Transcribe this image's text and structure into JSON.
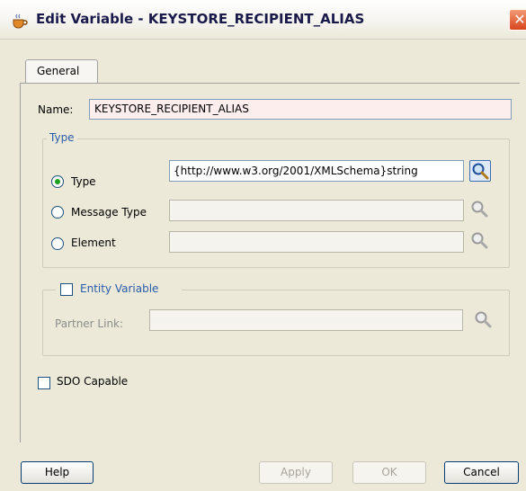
{
  "window": {
    "title": "Edit Variable - KEYSTORE_RECIPIENT_ALIAS",
    "close_glyph": "✕"
  },
  "tabs": [
    {
      "label": "General"
    }
  ],
  "name_field": {
    "label": "Name:",
    "value": "KEYSTORE_RECIPIENT_ALIAS"
  },
  "type_group": {
    "legend": "Type",
    "options": [
      {
        "label": "Type",
        "value": "{http://www.w3.org/2001/XMLSchema}string",
        "selected": true
      },
      {
        "label": "Message Type",
        "value": "",
        "selected": false
      },
      {
        "label": "Element",
        "value": "",
        "selected": false
      }
    ]
  },
  "entity_group": {
    "legend": "Entity Variable",
    "partner_link_label": "Partner Link:",
    "partner_link_value": ""
  },
  "sdo_capable": {
    "label": "SDO Capable",
    "checked": false
  },
  "buttons": {
    "help": "Help",
    "apply": "Apply",
    "ok": "OK",
    "cancel": "Cancel"
  },
  "colors": {
    "accent_blue": "#2a5caa",
    "name_field_bg": "#fdeeee",
    "close_red": "#d9441b"
  }
}
